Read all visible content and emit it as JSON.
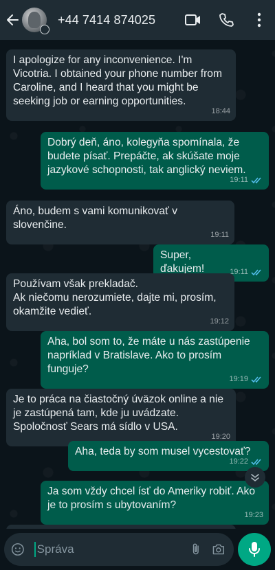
{
  "header": {
    "contact": "+44 7414 874025"
  },
  "messages": [
    {
      "dir": "in",
      "text": "I apologize for any inconvenience. I'm Vicotria. I obtained your phone number from Caroline, and I heard that you might be seeking job or earning opportunities.",
      "time": "18:44"
    },
    {
      "dir": "out",
      "text": "Dobrý deň, áno, kolegyňa spomínala, že budete písať. Prepáčte, ak skúšate  moje jazykové schopnosti, tak anglický neviem.",
      "time": "19:11",
      "status": "read"
    },
    {
      "dir": "in",
      "text": "Áno, budem s vami komunikovať v slovenčine.",
      "time": "19:11"
    },
    {
      "dir": "out",
      "text": "Super, ďakujem!",
      "time": "19:11",
      "status": "read"
    },
    {
      "dir": "in",
      "text": "Používam však prekladač.\nAk niečomu nerozumiete, dajte mi, prosím, okamžite vedieť.",
      "time": "19:12"
    },
    {
      "dir": "out",
      "text": "Aha, bol som to, že máte u nás zastúpenie napríklad v Bratislave. Ako to prosím funguje?",
      "time": "19:19",
      "status": "read"
    },
    {
      "dir": "in",
      "text": "Je to práca na čiastočný úväzok online a nie je zastúpená tam, kde ju uvádzate. Spoločnosť Sears má sídlo v USA.",
      "time": "19:20"
    },
    {
      "dir": "out",
      "text": "Aha, teda by som musel vycestovať?",
      "time": "19:22",
      "status": "read"
    },
    {
      "dir": "out",
      "text": "Ja som vždy chcel ísť do Ameriky robiť. Ako je to prosím s ubytovaním?",
      "time": "19:23",
      "status": "sent"
    }
  ],
  "composer": {
    "placeholder": "Správa"
  },
  "colors": {
    "incoming": "#1f2c34",
    "outgoing": "#005c4b",
    "accent": "#00a884",
    "read_ticks": "#53bdeb"
  },
  "icons": [
    "back-arrow-icon",
    "video-call-icon",
    "phone-icon",
    "more-vert-icon",
    "chevron-down-icon",
    "emoji-icon",
    "attach-icon",
    "camera-icon",
    "mic-icon"
  ]
}
